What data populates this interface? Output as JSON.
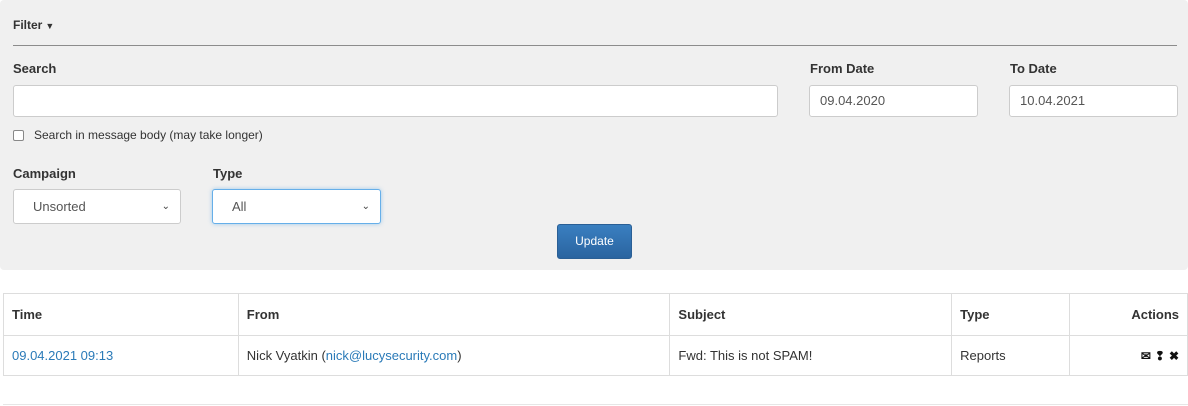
{
  "filter": {
    "title": "Filter",
    "search_label": "Search",
    "search_value": "",
    "from_label": "From Date",
    "from_value": "09.04.2020",
    "to_label": "To Date",
    "to_value": "10.04.2021",
    "body_search_label": "Search in message body (may take longer)",
    "body_search_checked": false,
    "campaign_label": "Campaign",
    "campaign_value": "Unsorted",
    "type_label": "Type",
    "type_value": "All",
    "update_label": "Update"
  },
  "table": {
    "headers": [
      "Time",
      "From",
      "Subject",
      "Type",
      "Actions"
    ],
    "rows": [
      {
        "time": "09.04.2021 09:13",
        "from_name": "Nick Vyatkin (",
        "from_email": "nick@lucysecurity.com",
        "from_close": ")",
        "subject": "Fwd: This is not SPAM!",
        "type": "Reports",
        "actions": [
          "envelope-icon",
          "info-icon",
          "delete-icon"
        ]
      }
    ]
  },
  "colors": {
    "panel_bg": "#f0f0f0",
    "button_bg": "#2e6da4",
    "link": "#2a7ab8"
  }
}
